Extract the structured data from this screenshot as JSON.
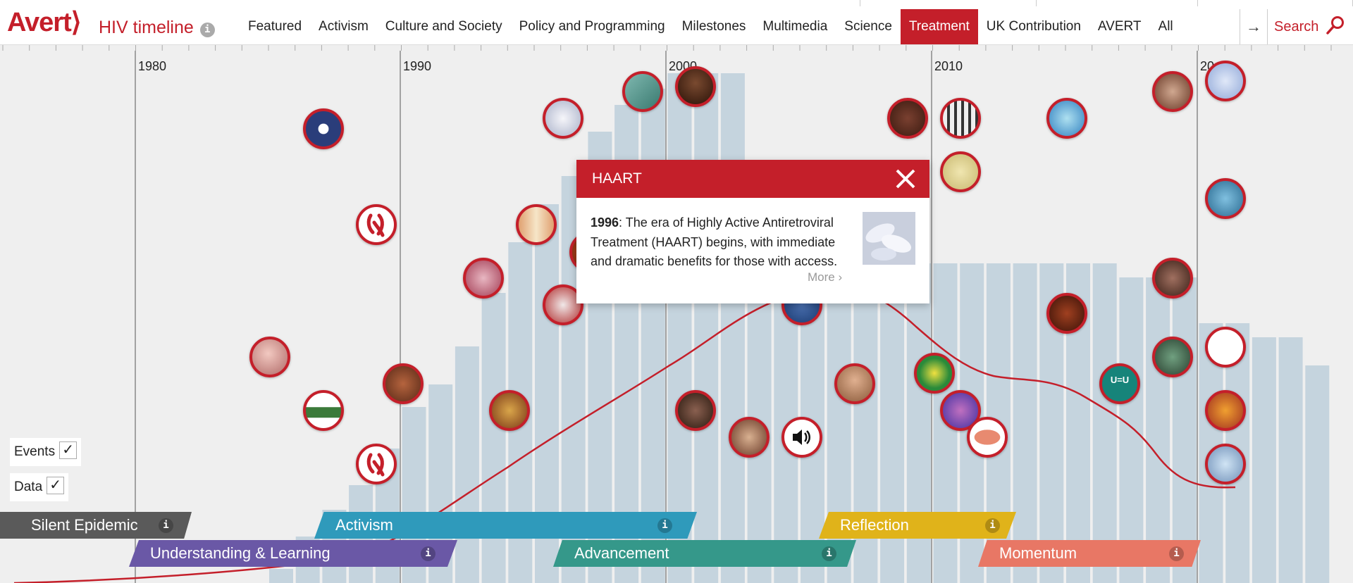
{
  "header": {
    "logo": "Avert⟩",
    "title": "HIV timeline",
    "title_info": "i",
    "nav": [
      "Featured",
      "Activism",
      "Culture and Society",
      "Policy and Programming",
      "Milestones",
      "Multimedia",
      "Science",
      "Treatment",
      "UK Contribution",
      "AVERT",
      "All"
    ],
    "active_nav": "Treatment",
    "arrow": "→",
    "search_label": "Search"
  },
  "decades": [
    "1980",
    "1990",
    "2000",
    "2010",
    "20"
  ],
  "toggles": {
    "events_label": "Events",
    "events_check": "✓",
    "data_label": "Data",
    "data_check": "✓"
  },
  "eras": [
    {
      "label": "Silent Epidemic",
      "info": "i",
      "color": "#5a5a5a"
    },
    {
      "label": "Understanding & Learning",
      "info": "i",
      "color": "#6a58a6"
    },
    {
      "label": "Activism",
      "info": "i",
      "color": "#2f9abb"
    },
    {
      "label": "Advancement",
      "info": "i",
      "color": "#35988a"
    },
    {
      "label": "Reflection",
      "info": "i",
      "color": "#e0b31a"
    },
    {
      "label": "Momentum",
      "info": "i",
      "color": "#e87765"
    }
  ],
  "popup": {
    "title": "HAART",
    "year": "1996",
    "text": ": The era of Highly Active Antiretroviral Treatment (HAART) begins, with immediate and dramatic benefits for those with access.",
    "more": "More ›"
  },
  "colors": {
    "brand_red": "#c41f2a",
    "bars": "#c5d4de",
    "background": "#efefef"
  }
}
